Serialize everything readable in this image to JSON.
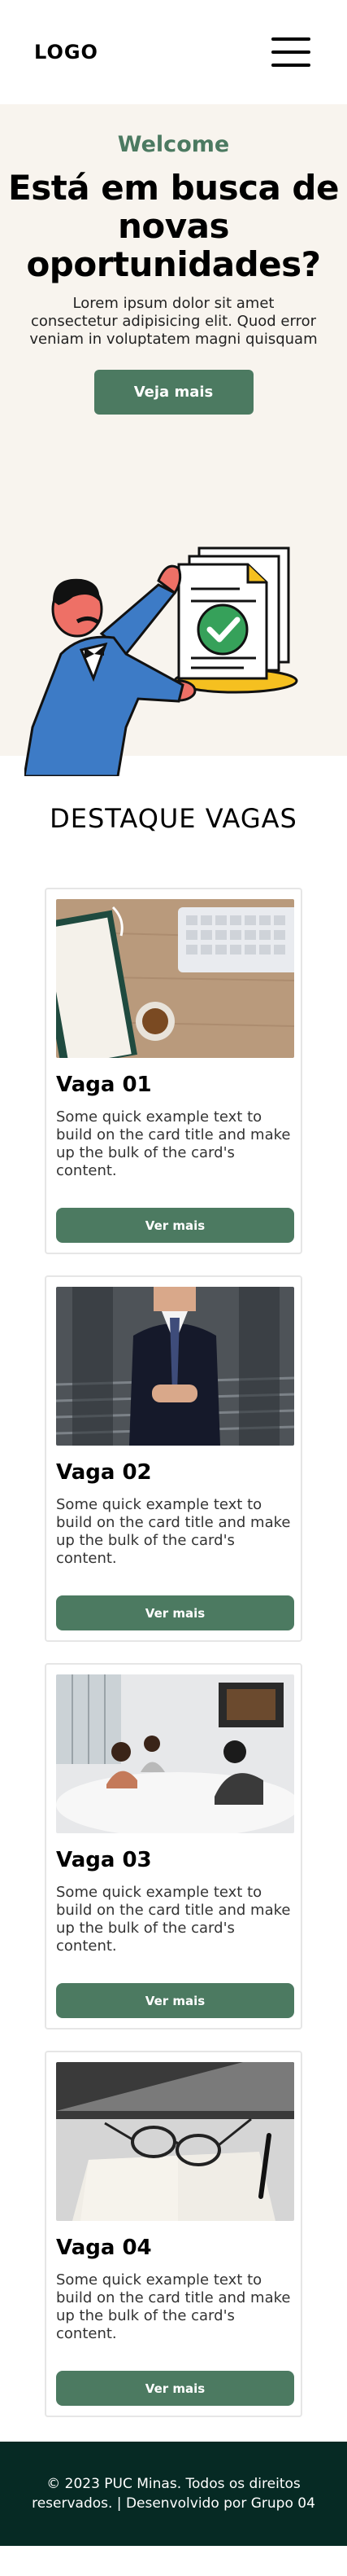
{
  "header": {
    "logo": "LOGO",
    "menu_icon": "hamburger-menu-icon"
  },
  "hero": {
    "welcome": "Welcome",
    "title": "Está em busca de novas oportunidades?",
    "text": "Lorem ipsum dolor sit amet consectetur adipisicing elit. Quod error veniam in voluptatem magni quisquam",
    "button_label": "Veja mais",
    "illustration": "man-presenting-approved-documents-illustration"
  },
  "section": {
    "title": "DESTAQUE VAGAS"
  },
  "cards": [
    {
      "title": "Vaga 01",
      "text": "Some quick example text to build on the card title and make up the bulk of the card's content.",
      "button_label": "Ver mais",
      "image": "desk-keyboard-coffee-photo"
    },
    {
      "title": "Vaga 02",
      "text": "Some quick example text to build on the card title and make up the bulk of the card's content.",
      "button_label": "Ver mais",
      "image": "businessman-suit-photo"
    },
    {
      "title": "Vaga 03",
      "text": "Some quick example text to build on the card title and make up the bulk of the card's content.",
      "button_label": "Ver mais",
      "image": "meeting-room-photo"
    },
    {
      "title": "Vaga 04",
      "text": "Some quick example text to build on the card title and make up the bulk of the card's content.",
      "button_label": "Ver mais",
      "image": "glasses-notebook-pen-photo"
    }
  ],
  "footer": {
    "text": "© 2023 PUC Minas. Todos os direitos reservados. | Desenvolvido por Grupo 04"
  },
  "colors": {
    "accent": "#4c7a61",
    "hero_bg": "#f8f4ee",
    "footer_bg": "#062a24"
  }
}
